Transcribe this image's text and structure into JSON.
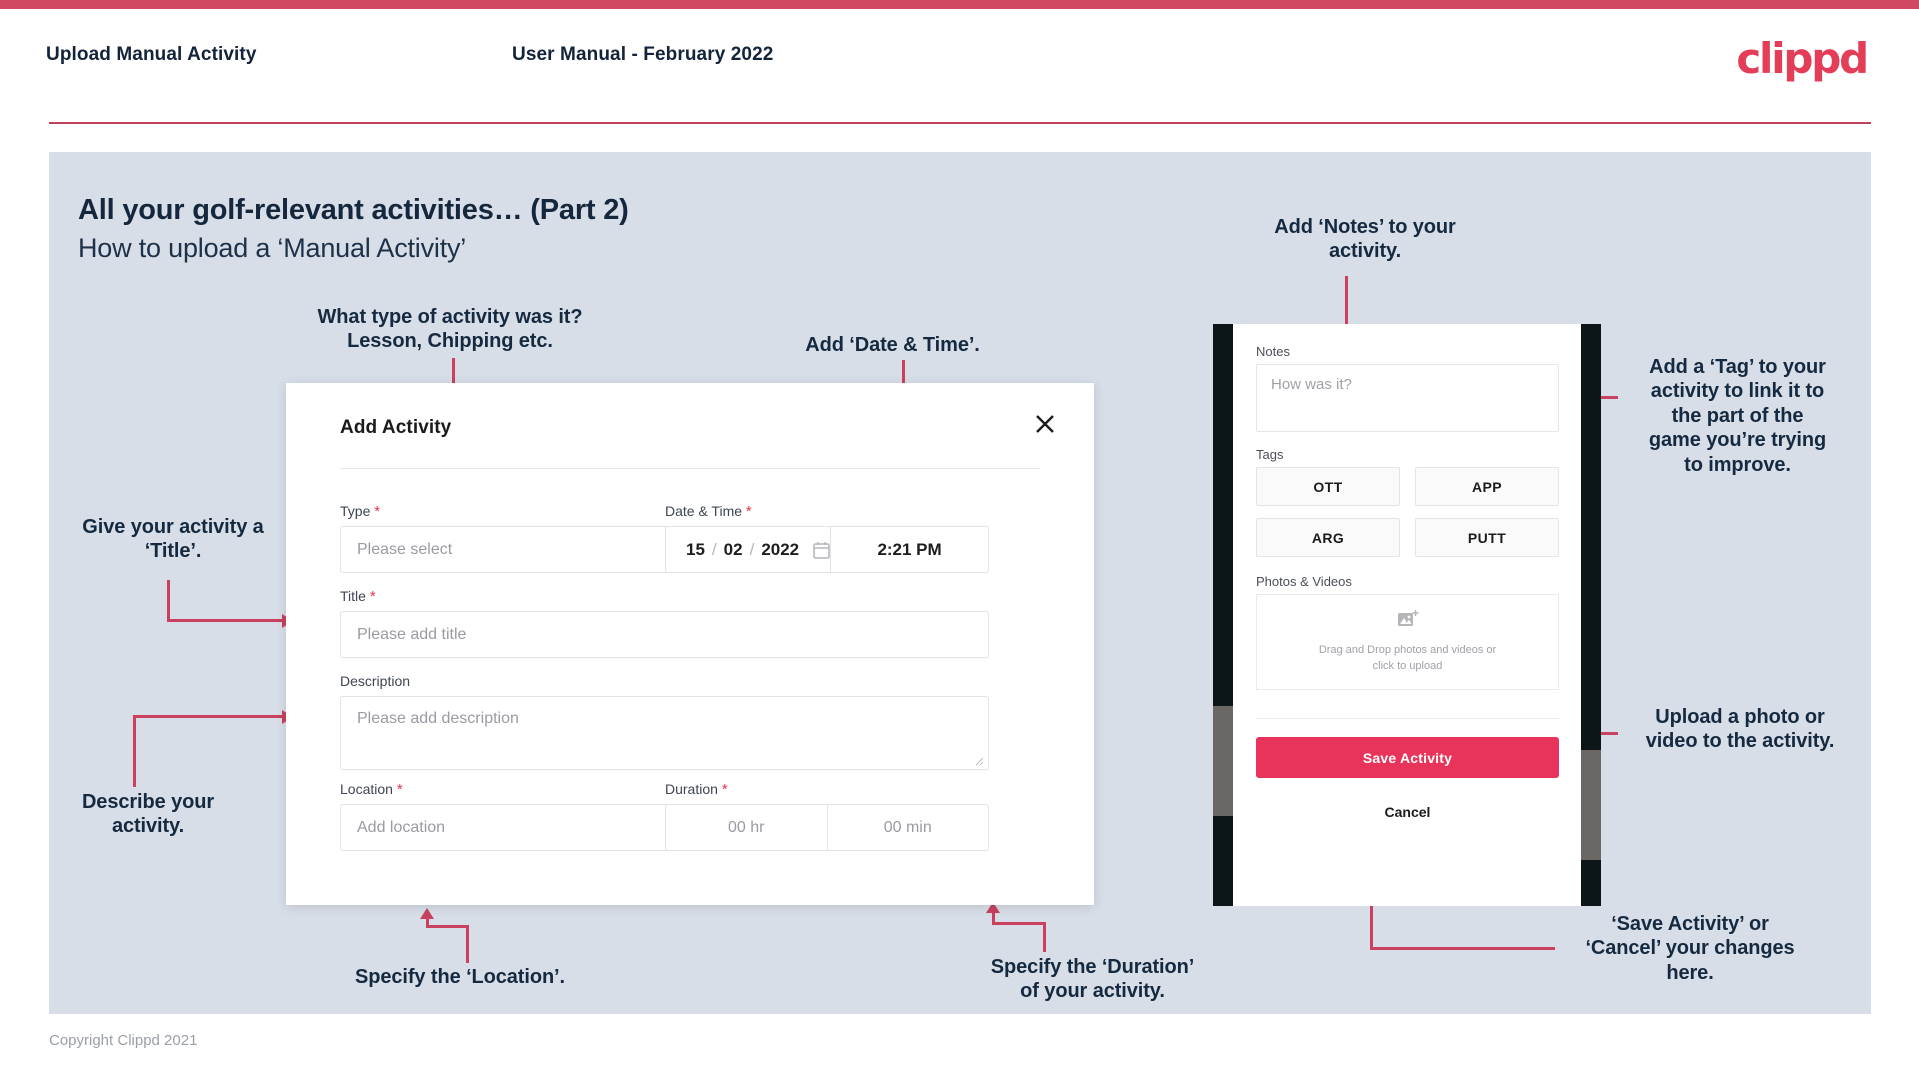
{
  "header": {
    "title": "Upload Manual Activity",
    "subtitle": "User Manual - February 2022",
    "logo": "clippd"
  },
  "slide": {
    "title": "All your golf-relevant activities… (Part 2)",
    "subtitle": "How to upload a ‘Manual Activity’"
  },
  "annotations": {
    "type": "What type of activity was it?\nLesson, Chipping etc.",
    "datetime": "Add ‘Date & Time’.",
    "notes": "Add ‘Notes’ to your\nactivity.",
    "tag": "Add a ‘Tag’ to your\nactivity to link it to\nthe part of the\ngame you’re trying\nto improve.",
    "title": "Give your activity a\n‘Title’.",
    "describe": "Describe your\nactivity.",
    "location": "Specify the ‘Location’.",
    "duration": "Specify the ‘Duration’\nof your activity.",
    "upload": "Upload a photo or\nvideo to the activity.",
    "save": "‘Save Activity’ or\n‘Cancel’ your changes\nhere."
  },
  "dialog": {
    "title": "Add Activity",
    "close_icon": "close-icon",
    "fields": {
      "type": {
        "label": "Type",
        "required": "*",
        "placeholder": "Please select",
        "value": ""
      },
      "datetime": {
        "label": "Date & Time",
        "required": "*",
        "day": "15",
        "month": "02",
        "year": "2022",
        "sep": "/",
        "time": "2:21 PM",
        "calendar_icon": "calendar-icon"
      },
      "title": {
        "label": "Title",
        "required": "*",
        "placeholder": "Please add title",
        "value": ""
      },
      "description": {
        "label": "Description",
        "required": "",
        "placeholder": "Please add description",
        "value": ""
      },
      "location": {
        "label": "Location",
        "required": "*",
        "placeholder": "Add location",
        "value": ""
      },
      "duration": {
        "label": "Duration",
        "required": "*",
        "hours_placeholder": "00 hr",
        "minutes_placeholder": "00 min"
      }
    }
  },
  "phone": {
    "notes": {
      "label": "Notes",
      "placeholder": "How was it?",
      "value": ""
    },
    "tags": {
      "label": "Tags",
      "items": [
        "OTT",
        "APP",
        "ARG",
        "PUTT"
      ]
    },
    "photos": {
      "label": "Photos & Videos",
      "dropzone_line1": "Drag and Drop photos and videos or",
      "dropzone_line2": "click to upload",
      "icon": "add-image-icon"
    },
    "save_label": "Save Activity",
    "cancel_label": "Cancel"
  },
  "footer": {
    "copyright": "Copyright Clippd 2021"
  },
  "colors": {
    "brand_pink": "#e8345a",
    "accent_rule": "#cf4763",
    "arrow": "#c9415e",
    "slide_bg": "#d8dee7",
    "text_dark": "#15273c"
  }
}
